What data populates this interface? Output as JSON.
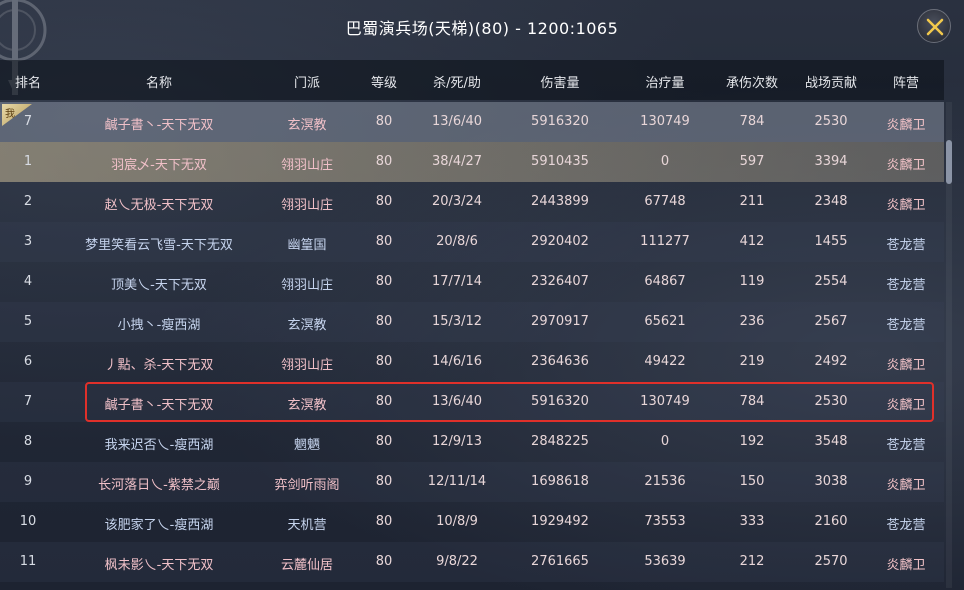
{
  "window": {
    "title": "巴蜀演兵场(天梯)(80) - 1200:1065",
    "close_icon": "close-icon"
  },
  "columns": [
    "排名",
    "名称",
    "门派",
    "等级",
    "杀/死/助",
    "伤害量",
    "治疗量",
    "承伤次数",
    "战场贡献",
    "阵营"
  ],
  "pinned_tag": "我",
  "rows": [
    {
      "rank": "7",
      "name": "鹹子書丶-天下无双",
      "sect": "玄溟教",
      "level": "80",
      "kda": "13/6/40",
      "damage": "5916320",
      "healing": "130749",
      "hits_taken": "784",
      "contribution": "2530",
      "faction": "炎麟卫"
    },
    {
      "rank": "1",
      "name": "羽宸乄-天下无双",
      "sect": "翎羽山庄",
      "level": "80",
      "kda": "38/4/27",
      "damage": "5910435",
      "healing": "0",
      "hits_taken": "597",
      "contribution": "3394",
      "faction": "炎麟卫"
    },
    {
      "rank": "2",
      "name": "赵乀无极-天下无双",
      "sect": "翎羽山庄",
      "level": "80",
      "kda": "20/3/24",
      "damage": "2443899",
      "healing": "67748",
      "hits_taken": "211",
      "contribution": "2348",
      "faction": "炎麟卫"
    },
    {
      "rank": "3",
      "name": "梦里笑看云飞雪-天下无双",
      "sect": "幽篁国",
      "level": "80",
      "kda": "20/8/6",
      "damage": "2920402",
      "healing": "111277",
      "hits_taken": "412",
      "contribution": "1455",
      "faction": "苍龙营"
    },
    {
      "rank": "4",
      "name": "顶美乀-天下无双",
      "sect": "翎羽山庄",
      "level": "80",
      "kda": "17/7/14",
      "damage": "2326407",
      "healing": "64867",
      "hits_taken": "119",
      "contribution": "2554",
      "faction": "苍龙营"
    },
    {
      "rank": "5",
      "name": "小拽丶-瘦西湖",
      "sect": "玄溟教",
      "level": "80",
      "kda": "15/3/12",
      "damage": "2970917",
      "healing": "65621",
      "hits_taken": "236",
      "contribution": "2567",
      "faction": "苍龙营"
    },
    {
      "rank": "6",
      "name": "丿點、杀-天下无双",
      "sect": "翎羽山庄",
      "level": "80",
      "kda": "14/6/16",
      "damage": "2364636",
      "healing": "49422",
      "hits_taken": "219",
      "contribution": "2492",
      "faction": "炎麟卫"
    },
    {
      "rank": "7",
      "name": "鹹子書丶-天下无双",
      "sect": "玄溟教",
      "level": "80",
      "kda": "13/6/40",
      "damage": "5916320",
      "healing": "130749",
      "hits_taken": "784",
      "contribution": "2530",
      "faction": "炎麟卫"
    },
    {
      "rank": "8",
      "name": "我来迟否乀-瘦西湖",
      "sect": "魍魉",
      "level": "80",
      "kda": "12/9/13",
      "damage": "2848225",
      "healing": "0",
      "hits_taken": "192",
      "contribution": "3548",
      "faction": "苍龙营"
    },
    {
      "rank": "9",
      "name": "长河落日乀-紫禁之巅",
      "sect": "弈剑听雨阁",
      "level": "80",
      "kda": "12/11/14",
      "damage": "1698618",
      "healing": "21536",
      "hits_taken": "150",
      "contribution": "3038",
      "faction": "炎麟卫"
    },
    {
      "rank": "10",
      "name": "该肥家了乀-瘦西湖",
      "sect": "天机营",
      "level": "80",
      "kda": "10/8/9",
      "damage": "1929492",
      "healing": "73553",
      "hits_taken": "333",
      "contribution": "2160",
      "faction": "苍龙营"
    },
    {
      "rank": "11",
      "name": "枫未影乀-天下无双",
      "sect": "云麓仙居",
      "level": "80",
      "kda": "9/8/22",
      "damage": "2761665",
      "healing": "53639",
      "hits_taken": "212",
      "contribution": "2570",
      "faction": "炎麟卫"
    }
  ],
  "colors": {
    "faction_red": "#f3c3c8",
    "faction_blue": "#c8d6f0",
    "highlight_border": "#e0302a"
  }
}
